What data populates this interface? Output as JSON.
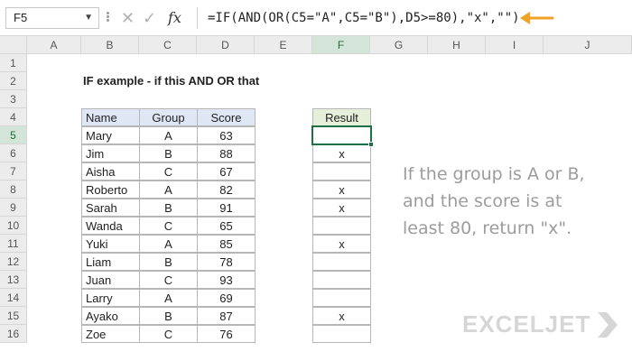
{
  "formula_bar": {
    "name_box": "F5",
    "fx_label": "fx",
    "formula": "=IF(AND(OR(C5=\"A\",C5=\"B\"),D5>=80),\"x\",\"\")",
    "arrow_color": "#f0a324"
  },
  "columns": [
    "A",
    "B",
    "C",
    "D",
    "E",
    "F",
    "G",
    "H",
    "I",
    "J"
  ],
  "rows": [
    "1",
    "2",
    "3",
    "4",
    "5",
    "6",
    "7",
    "8",
    "9",
    "10",
    "11",
    "12",
    "13",
    "14",
    "15",
    "16"
  ],
  "title": "IF example - if this AND OR that",
  "table": {
    "headers": [
      "Name",
      "Group",
      "Score"
    ],
    "rows": [
      [
        "Mary",
        "A",
        "63"
      ],
      [
        "Jim",
        "B",
        "88"
      ],
      [
        "Aisha",
        "C",
        "67"
      ],
      [
        "Roberto",
        "A",
        "82"
      ],
      [
        "Sarah",
        "B",
        "91"
      ],
      [
        "Wanda",
        "C",
        "65"
      ],
      [
        "Yuki",
        "A",
        "85"
      ],
      [
        "Liam",
        "B",
        "78"
      ],
      [
        "Juan",
        "C",
        "93"
      ],
      [
        "Larry",
        "A",
        "69"
      ],
      [
        "Ayako",
        "B",
        "87"
      ],
      [
        "Zoe",
        "C",
        "76"
      ]
    ]
  },
  "result": {
    "header": "Result",
    "values": [
      "",
      "x",
      "",
      "x",
      "x",
      "",
      "x",
      "",
      "",
      "",
      "x",
      ""
    ]
  },
  "note": [
    "If the group is A or B,",
    "and the score is at",
    "least 80, return \"x\"."
  ],
  "logo": "EXCELJET",
  "active_cell": "F5",
  "colors": {
    "header_fill": "#dfe7f5",
    "result_header_fill": "#e6efd9",
    "selection": "#1e7145"
  }
}
